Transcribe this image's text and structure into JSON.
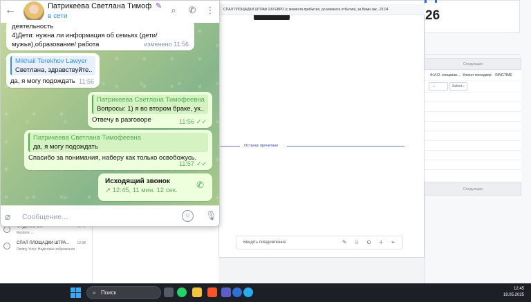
{
  "crm": {
    "big_number": "26",
    "window_title": "СПАЛ ПЛОЩАДКИ ШТРАФ 100 ЕВРО (с момента прибытия, до момента отбытия), за Вами зак...23.04",
    "bar_top_label": "Следующая",
    "bar_bottom_label": "Следующая",
    "table_headers": [
      "Ф.И.О. специали...",
      "Клиент менеджер",
      "RINGTIME"
    ],
    "filter_select": "Select..",
    "divider_label": "Останнє прочитане",
    "compose_placeholder": "Введіть повідомлення",
    "list": [
      {
        "title": "Флудилка ОП",
        "subtitle": "Ruslana: ...",
        "time": "12:42"
      },
      {
        "title": "СПАЛ ПЛОЩАДКИ ШТРА...",
        "subtitle": "Dmitriy Yuriy: Надіслане зображення",
        "time": "12:38"
      }
    ]
  },
  "telegram": {
    "contact_name": "Патрикеева Светлана Тимофеевна",
    "status": "в сети",
    "input_placeholder": "Сообщение...",
    "messages": [
      {
        "direction": "in",
        "lines": [
          "деятельность",
          "4)Дети: нужна ли информация об семьях (дети/",
          "мужья),образование/ работа"
        ],
        "time": "изменено 11:56"
      },
      {
        "direction": "in",
        "reply_name": "Mikhail Terekhov Lawyer",
        "reply_text": "Светлана, здравствуйте...",
        "text": "да, я могу подождать",
        "time": "11:56"
      },
      {
        "direction": "out",
        "reply_name": "Патрикеева Светлана Тимофеевна",
        "reply_text": "Вопросы: 1) я во втором браке, ук...",
        "text": "Отвечу в разговоре",
        "time": "11:56"
      },
      {
        "direction": "out",
        "reply_name": "Патрикеева Светлана Тимофеевна",
        "reply_text": "да, я могу подождать",
        "text": "Спасибо за понимания, наберу как только освобожусь.",
        "time": "11:57"
      }
    ],
    "call": {
      "title": "Исходящий звонок",
      "info": "↗ 12:45, 11 мин. 12 сек."
    }
  },
  "taskbar": {
    "search_label": "Поиск",
    "time": "12:45",
    "date": "19.05.2025"
  },
  "colors": {
    "telegram_blue": "#3390ec",
    "telegram_green": "#4fae4e",
    "outgoing_bubble": "#eeffde",
    "taskbar": "#1c1f26"
  }
}
